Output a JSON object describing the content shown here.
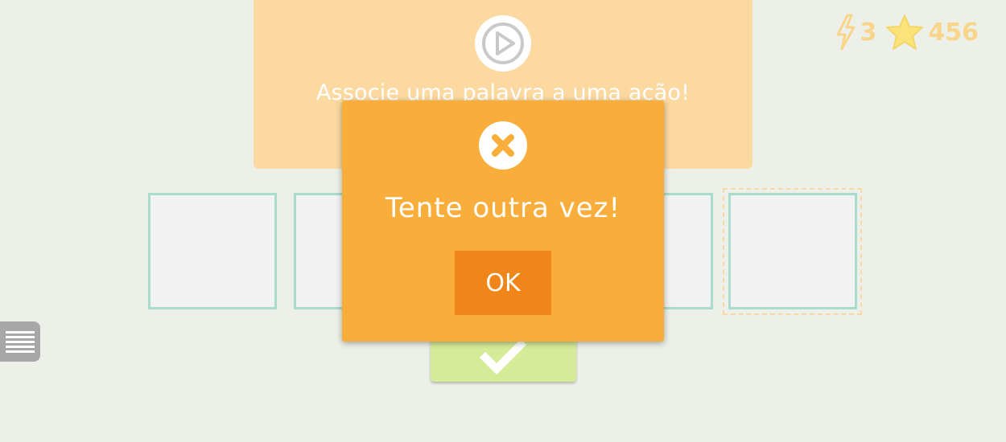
{
  "instruction": {
    "play_icon": "play-icon",
    "text": "Associe uma palavra a uma ação!"
  },
  "stats": {
    "energy_icon": "lightning-icon",
    "energy": "3",
    "star_icon": "star-icon",
    "score": "456"
  },
  "cards": [
    {
      "state": "empty"
    },
    {
      "state": "empty"
    },
    {
      "state": "empty"
    },
    {
      "state": "empty"
    }
  ],
  "menu_icon": "hamburger-menu-icon",
  "check_icon": "checkmark-icon",
  "dialog": {
    "icon": "error-x-icon",
    "message": "Tente outra vez!",
    "ok_label": "OK"
  },
  "colors": {
    "background": "#edf0e9",
    "panel": "#fbd9a0",
    "dialog": "#f9ae3b",
    "ok_button": "#f08519",
    "card_border": "#a9dccb",
    "check_button": "#d6eb98",
    "stats": "#f8d58a"
  }
}
